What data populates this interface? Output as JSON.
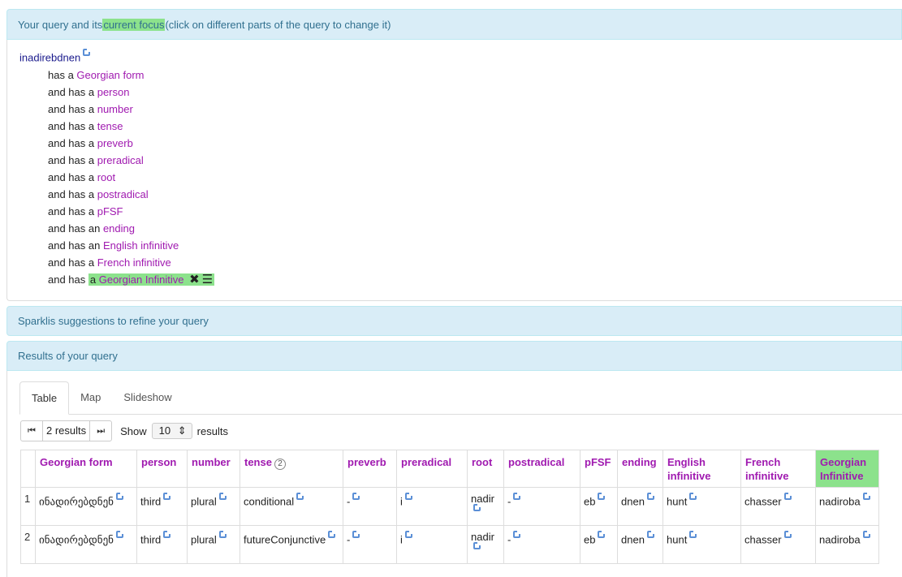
{
  "query_header": {
    "before": "Your query and its ",
    "highlight": "current focus",
    "after": " (click on different parts of the query to change it)"
  },
  "query": {
    "root": "inadirebdnen",
    "lines": [
      {
        "prefix": "has a ",
        "kw": "Georgian form"
      },
      {
        "prefix": "and has a ",
        "kw": "person"
      },
      {
        "prefix": "and has a ",
        "kw": "number"
      },
      {
        "prefix": "and has a ",
        "kw": "tense"
      },
      {
        "prefix": "and has a ",
        "kw": "preverb"
      },
      {
        "prefix": "and has a ",
        "kw": "preradical"
      },
      {
        "prefix": "and has a ",
        "kw": "root"
      },
      {
        "prefix": "and has a ",
        "kw": "postradical"
      },
      {
        "prefix": "and has a ",
        "kw": "pFSF"
      },
      {
        "prefix": "and has an ",
        "kw": "ending"
      },
      {
        "prefix": "and has an ",
        "kw": "English infinitive"
      },
      {
        "prefix": "and has a ",
        "kw": "French infinitive"
      }
    ],
    "focus_line": {
      "prefix": "and has ",
      "article": "a",
      "kw": "Georgian Infinitive",
      "delete_glyph": "✖",
      "menu_glyph": "☰"
    }
  },
  "suggestions_header": "Sparklis suggestions to refine your query",
  "results_header": "Results of your query",
  "tabs": [
    "Table",
    "Map",
    "Slideshow"
  ],
  "pager": {
    "first_glyph": "⏮",
    "count": "2 results",
    "next_glyph": "⏭",
    "show_label": "Show",
    "page_size": "10",
    "results_label": "results"
  },
  "table": {
    "columns": [
      "Georgian form",
      "person",
      "number",
      "tense",
      "preverb",
      "preradical",
      "root",
      "postradical",
      "pFSF",
      "ending",
      "English infinitive",
      "French infinitive",
      "Georgian Infinitive"
    ],
    "tense_badge": "2",
    "rows": [
      {
        "idx": "1",
        "cells": [
          "ინადირებდნენ",
          "third",
          "plural",
          "conditional",
          "-",
          "i",
          "nadir",
          "-",
          "eb",
          "dnen",
          "hunt",
          "chasser",
          "nadiroba"
        ]
      },
      {
        "idx": "2",
        "cells": [
          "ინადირებდნენ",
          "third",
          "plural",
          "futureConjunctive",
          "-",
          "i",
          "nadir",
          "-",
          "eb",
          "dnen",
          "hunt",
          "chasser",
          "nadiroba"
        ]
      }
    ]
  },
  "colors": {
    "panel_bg": "#d9edf7",
    "panel_text": "#31708f",
    "keyword": "#a01ab0",
    "focus": "#8ce28c",
    "link_icon": "#5b8fd6"
  }
}
